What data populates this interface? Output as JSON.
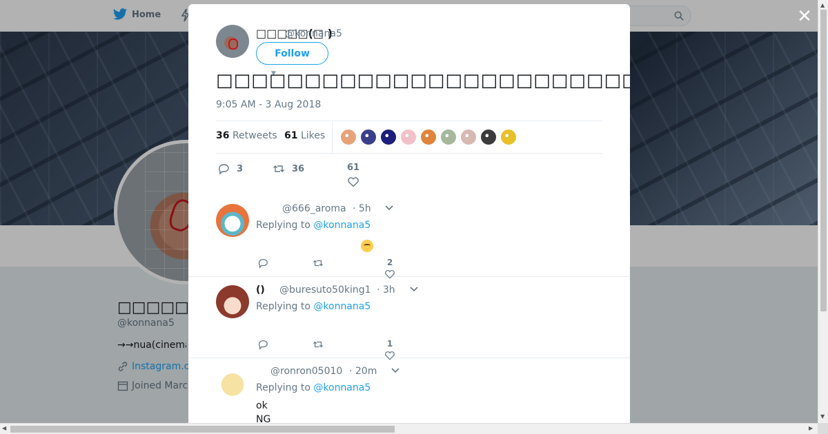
{
  "nav": {
    "home_label": "Home",
    "search_hint": ""
  },
  "profile": {
    "name": "□□□□□(□ )",
    "handle": "@konnana5",
    "bio": "→→nua(cinema",
    "link": "Instagram.c",
    "joined": "Joined Marc"
  },
  "modal": {
    "author_name": "□□□□□(□ )",
    "author_handle": "@konnana5",
    "follow_label": "Follow",
    "tweet_text": "□□□□□□□□□□□□□□□□□□□□□□□□□□□□□□□□□□□□□□□□□□□□□□□□",
    "time": "9:05 AM - 3 Aug 2018",
    "retweets_count": "36",
    "retweets_label": "Retweets",
    "likes_count": "61",
    "likes_label": "Likes",
    "likers": [
      "#e8a27a",
      "#3a3f8c",
      "#1d1f7a",
      "#f2c0c8",
      "#e0843c",
      "#a6b89c",
      "#d8b8b0",
      "#3c3c3c",
      "#e8c02a"
    ],
    "actions": {
      "reply": "3",
      "retweet": "36",
      "like": "61"
    }
  },
  "replies": [
    {
      "name": "",
      "handle": "@666_aroma",
      "time": "· 5h",
      "replying_prefix": "Replying to ",
      "replying_to": "@konnana5",
      "body": "",
      "has_emoji": true,
      "avatar_color": "#e8733c",
      "actions": {
        "reply": "",
        "retweet": "",
        "like": "2"
      }
    },
    {
      "name": "()",
      "handle": "@buresuto50king1",
      "time": "· 3h",
      "replying_prefix": "Replying to ",
      "replying_to": "@konnana5",
      "body": "",
      "has_emoji": false,
      "avatar_color": "#c85a3c",
      "actions": {
        "reply": "",
        "retweet": "",
        "like": "1"
      }
    },
    {
      "name": "",
      "handle": "@ronron05010",
      "time": "· 20m",
      "replying_prefix": "Replying to ",
      "replying_to": "@konnana5",
      "body_line1": "ok",
      "body_line2": "NG",
      "has_emoji": false,
      "avatar_color": "#f2e2a6",
      "actions": {
        "reply": "",
        "retweet": "",
        "like": ""
      }
    }
  ]
}
